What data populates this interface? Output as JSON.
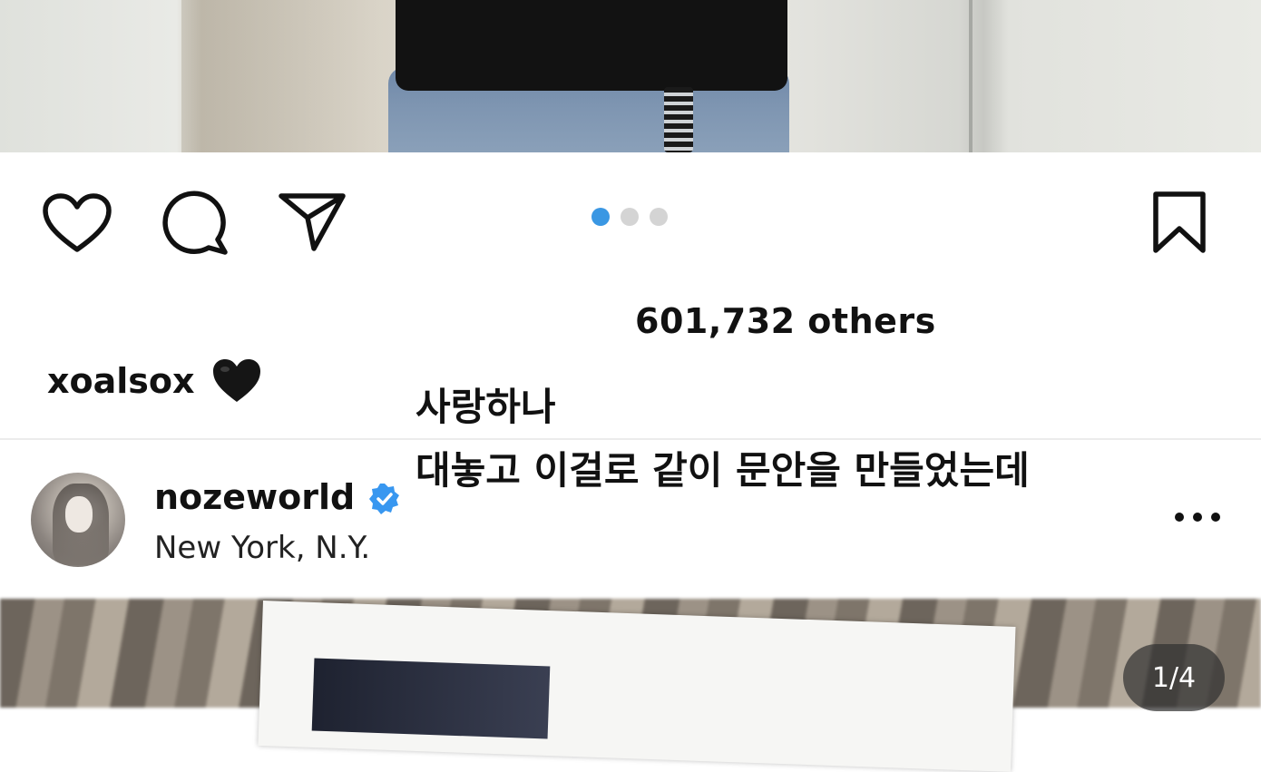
{
  "post_actions": {
    "like_icon": "heart-outline-icon",
    "comment_icon": "comment-bubble-icon",
    "share_icon": "paper-plane-icon",
    "save_icon": "bookmark-outline-icon",
    "carousel_dots": {
      "total": 3,
      "active_index": 0
    }
  },
  "likes": {
    "text": "601,732 others"
  },
  "caption": {
    "username": "xoalsox",
    "emoji": "black-heart-emoji"
  },
  "overlay_text": {
    "line1": "사랑하나",
    "line2": "대놓고 이걸로 같이 문안을 만들었는데"
  },
  "next_post": {
    "username": "nozeworld",
    "verified": true,
    "location": "New York, N.Y.",
    "more_icon": "more-horizontal-icon",
    "page_counter": "1/4"
  },
  "colors": {
    "accent_blue": "#3a97e3",
    "dot_inactive": "#d4d4d4",
    "text_primary": "#111111",
    "verified_blue": "#3897f0"
  }
}
